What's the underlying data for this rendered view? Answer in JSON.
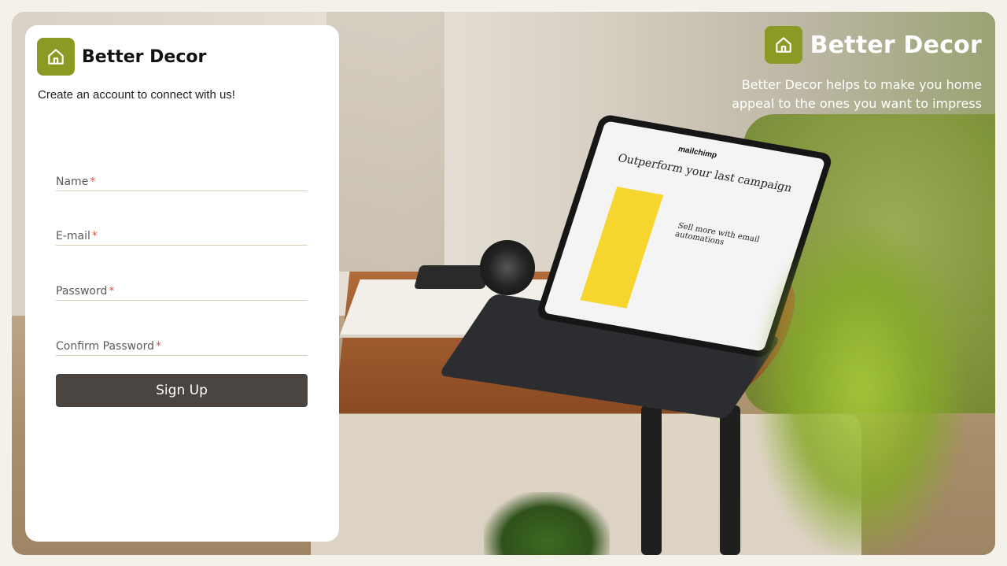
{
  "brand": {
    "name": "Better Decor",
    "logo_icon": "home-icon",
    "accent_color": "#8a9a23"
  },
  "hero": {
    "tagline": "Better Decor helps to make you home appeal to the ones you want to impress",
    "tablet_screen": {
      "logo": "mailchimp",
      "headline": "Outperform your last campaign",
      "subhead": "Sell more with email automations"
    }
  },
  "form": {
    "subtitle": "Create an account to connect with us!",
    "fields": [
      {
        "label": "Name",
        "required_mark": "*"
      },
      {
        "label": "E-mail",
        "required_mark": "*"
      },
      {
        "label": "Password",
        "required_mark": "*"
      },
      {
        "label": "Confirm Password",
        "required_mark": "*"
      }
    ],
    "submit_label": "Sign Up",
    "submit_color": "#4b4541"
  }
}
